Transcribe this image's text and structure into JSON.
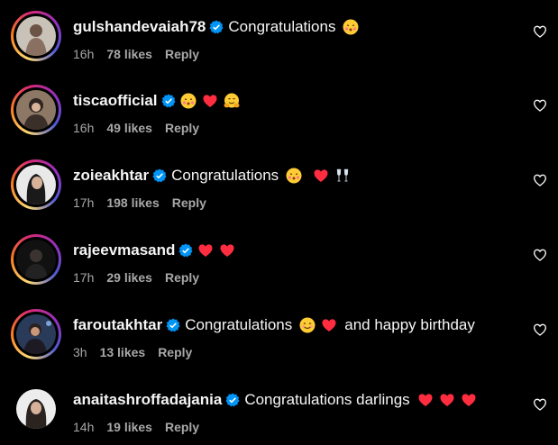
{
  "comments": [
    {
      "username": "gulshandevaiah78",
      "text": "Congratulations",
      "emojis": [
        "kissing-face"
      ],
      "tail": "",
      "time": "16h",
      "likes": "78 likes",
      "reply": "Reply",
      "story_ring": true
    },
    {
      "username": "tiscaofficial",
      "text": "",
      "emojis": [
        "kissing-face",
        "red-heart",
        "hugging-face"
      ],
      "tail": "",
      "time": "16h",
      "likes": "49 likes",
      "reply": "Reply",
      "story_ring": true
    },
    {
      "username": "zoieakhtar",
      "text": "Congratulations",
      "emojis": [
        "kissing-face",
        "red-heart",
        "clinking-glasses"
      ],
      "tail": "",
      "time": "17h",
      "likes": "198 likes",
      "reply": "Reply",
      "story_ring": true
    },
    {
      "username": "rajeevmasand",
      "text": "",
      "emojis": [
        "red-heart",
        "red-heart"
      ],
      "tail": "",
      "time": "17h",
      "likes": "29 likes",
      "reply": "Reply",
      "story_ring": true
    },
    {
      "username": "faroutakhtar",
      "text": "Congratulations",
      "emojis": [
        "smiling-face",
        "red-heart"
      ],
      "tail": "and happy birthday",
      "time": "3h",
      "likes": "13 likes",
      "reply": "Reply",
      "story_ring": true
    },
    {
      "username": "anaitashroffadajania",
      "text": "Congratulations darlings",
      "emojis": [
        "red-heart",
        "red-heart",
        "red-heart"
      ],
      "tail": "",
      "time": "14h",
      "likes": "19 likes",
      "reply": "Reply",
      "story_ring": false
    }
  ],
  "icons": {
    "verified": "verified-badge-icon",
    "like": "heart-outline-icon"
  },
  "colors": {
    "background": "#000000",
    "text": "#f5f5f5",
    "secondary": "#a8a8a8",
    "verified": "#0095f6",
    "heart": "#ff3040"
  }
}
